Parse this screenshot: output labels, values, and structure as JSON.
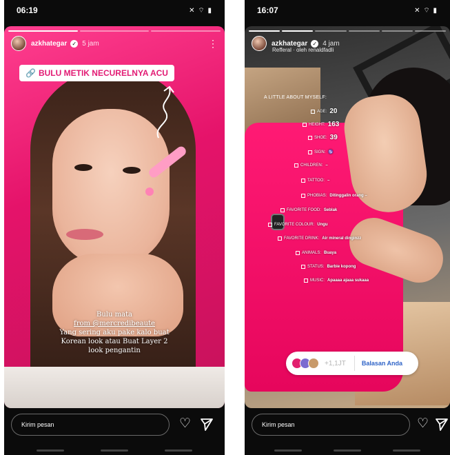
{
  "left": {
    "status": {
      "time": "06:19",
      "icons": "✕ ⌔ ▮"
    },
    "header": {
      "username": "azkhategar",
      "time": "5 jam",
      "more": "⋮"
    },
    "sticker": {
      "text": "BULU METIK NECURELNYA ACU",
      "icon": "link-icon"
    },
    "caption": {
      "line1": "Bulu mata",
      "line2": "from @mercredibeaute",
      "line3": "Yang sering aku pake kalo buat",
      "line4": "Korean look atau Buat Layer 2",
      "line5": "look pengantin"
    },
    "bottom": {
      "placeholder": "Kirim pesan"
    }
  },
  "right": {
    "status": {
      "time": "16:07",
      "icons": "✕ ⌔ ▮"
    },
    "header": {
      "username": "azkhategar",
      "time": "4 jam",
      "sub": "Refferal · oleh renaldfadli"
    },
    "about": {
      "title": "A LITTLE ABOUT MYSELF:",
      "rows": [
        {
          "label": "AGE:",
          "value": "20"
        },
        {
          "label": "HEIGHT:",
          "value": "163"
        },
        {
          "label": "SHOE:",
          "value": "39"
        },
        {
          "label": "SIGN:",
          "value": "♑"
        },
        {
          "label": "CHILDREN:",
          "value": "–"
        },
        {
          "label": "TATTOO:",
          "value": "–"
        },
        {
          "label": "PHOBIAS:",
          "value": "Ditinggalin orang –"
        },
        {
          "label": "FAVORITE FOOD:",
          "value": "Seblak"
        },
        {
          "label": "FAVORITE COLOUR:",
          "value": "Ungu"
        },
        {
          "label": "FAVORITE DRINK:",
          "value": "Air mineral dinginzz"
        },
        {
          "label": "ANIMALS:",
          "value": "Buaya"
        },
        {
          "label": "STATUS:",
          "value": "Barbie kopong"
        },
        {
          "label": "MUSIC:",
          "value": "Apaaaa ajaaa sukaaa"
        }
      ]
    },
    "replies": {
      "count": "+1,1JT",
      "button": "Balasan Anda"
    },
    "bottom": {
      "placeholder": "Kirim pesan"
    }
  }
}
